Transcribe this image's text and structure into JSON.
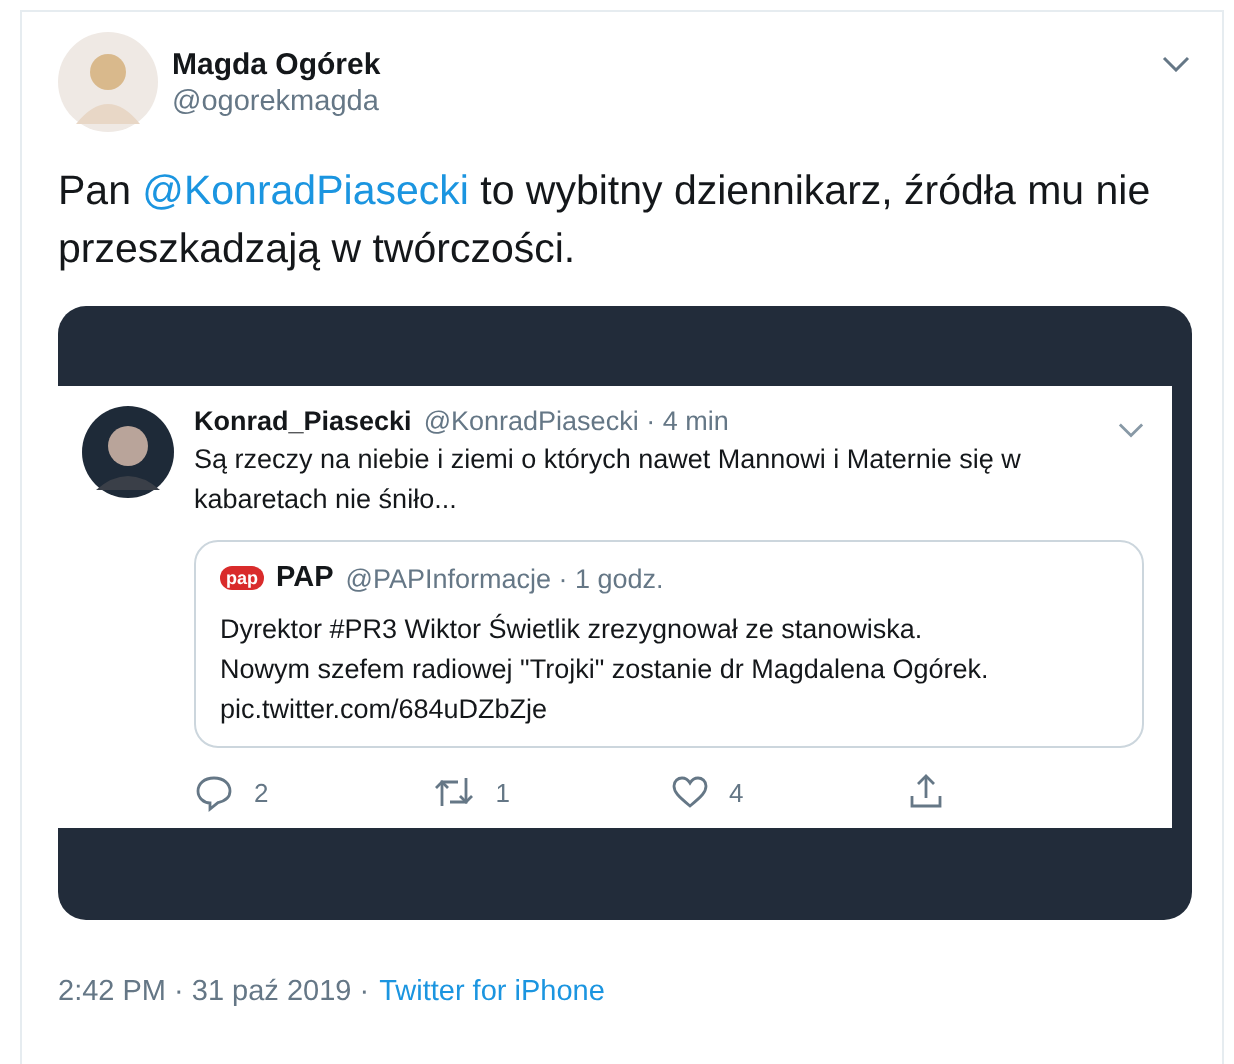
{
  "author": {
    "name": "Magda Ogórek",
    "handle": "@ogorekmagda"
  },
  "text": {
    "before": "Pan ",
    "mention": "@KonradPiasecki",
    "after": " to wybitny dziennikarz, źródła mu nie przeszkadzają w twórczości."
  },
  "embedded": {
    "name": "Konrad_Piasecki",
    "meta": "@KonradPiasecki · 4 min",
    "text": "Są rzeczy na niebie i ziemi o których nawet Mannowi i Maternie się w kabaretach nie śniło...",
    "quoted": {
      "logo": "pap",
      "name": "PAP",
      "meta": "@PAPInformacje · 1 godz.",
      "lines": [
        "Dyrektor #PR3 Wiktor Świetlik zrezygnował ze stanowiska.",
        "Nowym szefem radiowej \"Trojki\" zostanie dr Magdalena Ogórek.",
        "pic.twitter.com/684uDZbZje"
      ]
    },
    "actions": [
      {
        "kind": "reply",
        "count": "2"
      },
      {
        "kind": "retweet",
        "count": "1"
      },
      {
        "kind": "like",
        "count": "4"
      },
      {
        "kind": "share"
      }
    ]
  },
  "footer": {
    "time": "2:42 PM · 31 paź 2019 ·",
    "source": "Twitter for iPhone"
  }
}
